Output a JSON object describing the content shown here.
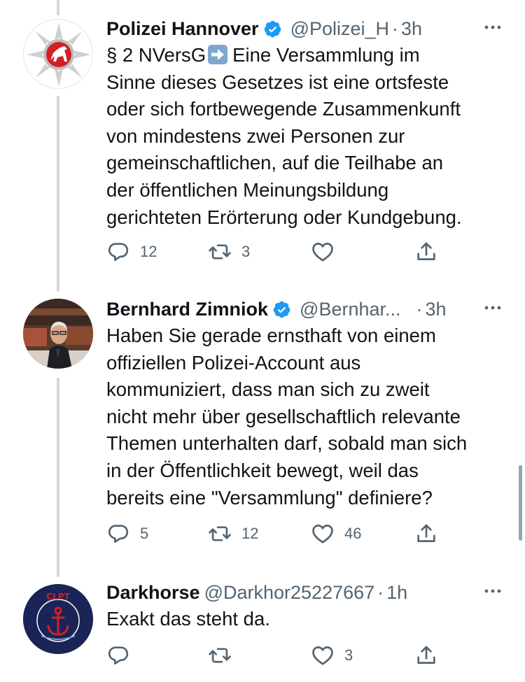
{
  "tweets": [
    {
      "name": "Polizei Hannover",
      "handle": "@Polizei_H",
      "time": "3h",
      "lines": [
        "§ 2 NVersG",
        "Eine Versammlung im",
        "Sinne dieses Gesetzes ist eine ortsfeste",
        "oder sich fortbewegende Zusammenkunft",
        "von mindestens zwei Personen zur",
        "gemeinschaftlichen, auf die Teilhabe an",
        "der öffentlichen Meinungsbildung",
        "gerichteten Erörterung oder Kundgebung."
      ],
      "replies": "12",
      "retweets": "3",
      "likes": ""
    },
    {
      "name": "Bernhard Zimniok",
      "handle": "@Bernhar...",
      "time": "3h",
      "lines": [
        "Haben Sie gerade ernsthaft von einem",
        "offiziellen Polizei-Account aus",
        "kommuniziert, dass man sich zu zweit",
        "nicht mehr über gesellschaftlich relevante",
        "Themen unterhalten darf, sobald man sich",
        "in der Öffentlichkeit bewegt, weil das",
        "bereits eine \"Versammlung\" definiere?"
      ],
      "replies": "5",
      "retweets": "12",
      "likes": "46"
    },
    {
      "name": "Darkhorse",
      "handle": "@Darkhor25227667",
      "time": "1h",
      "lines": [
        "Exakt das steht da."
      ],
      "replies": "",
      "retweets": "",
      "likes": "3",
      "avatar_text": "CLPT"
    }
  ],
  "colors": {
    "text": "#0f1419",
    "secondary": "#536471",
    "verified": "#1d9bf0",
    "thread_line": "#cfd9de",
    "police_red": "#d21f26",
    "navy": "#1b2456"
  }
}
